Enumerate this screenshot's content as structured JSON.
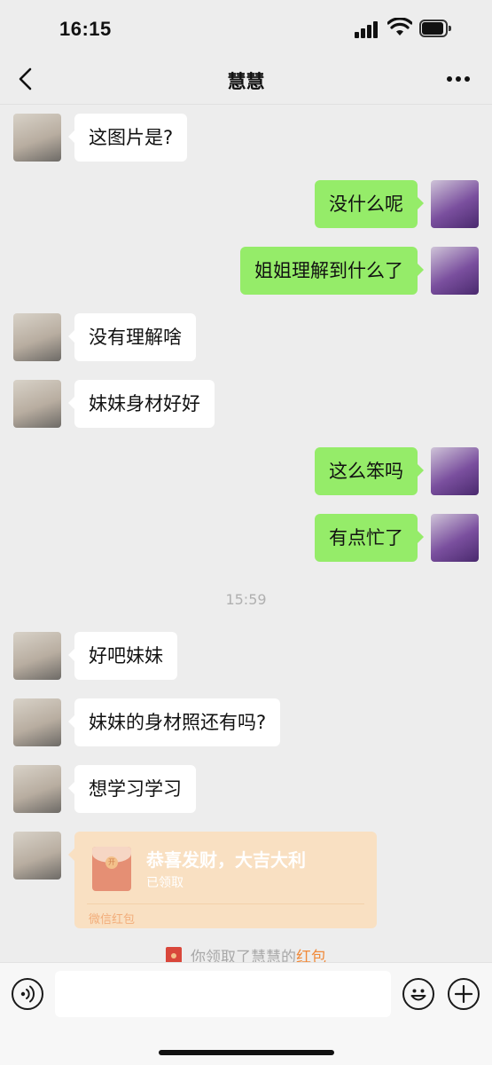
{
  "status": {
    "time": "16:15"
  },
  "nav": {
    "title": "慧慧"
  },
  "messages": [
    {
      "side": "left",
      "text": "这图片是?"
    },
    {
      "side": "right",
      "text": "没什么呢"
    },
    {
      "side": "right",
      "text": "姐姐理解到什么了"
    },
    {
      "side": "left",
      "text": "没有理解啥"
    },
    {
      "side": "left",
      "text": "妹妹身材好好"
    },
    {
      "side": "right",
      "text": "这么笨吗"
    },
    {
      "side": "right",
      "text": "有点忙了"
    },
    {
      "side": "left",
      "text": "好吧妹妹"
    },
    {
      "side": "left",
      "text": "妹妹的身材照还有吗?"
    },
    {
      "side": "left",
      "text": "想学习学习"
    }
  ],
  "timestamp": "15:59",
  "red_packet": {
    "title": "恭喜发财，大吉大利",
    "status": "已领取",
    "footer": "微信红包",
    "coin_glyph": "开"
  },
  "system_note": {
    "prefix": "你领取了慧慧的",
    "link": "红包"
  },
  "input": {
    "value": ""
  },
  "icons": {
    "back": "chevron-left-icon",
    "more": "more-dots-icon",
    "voice": "voice-icon",
    "emoji": "emoji-icon",
    "plus": "plus-icon"
  },
  "colors": {
    "background": "#ededed",
    "bubble_self": "#95ec69",
    "bubble_other": "#ffffff",
    "red_packet": "#f9e0c2",
    "link": "#f08a3a"
  }
}
